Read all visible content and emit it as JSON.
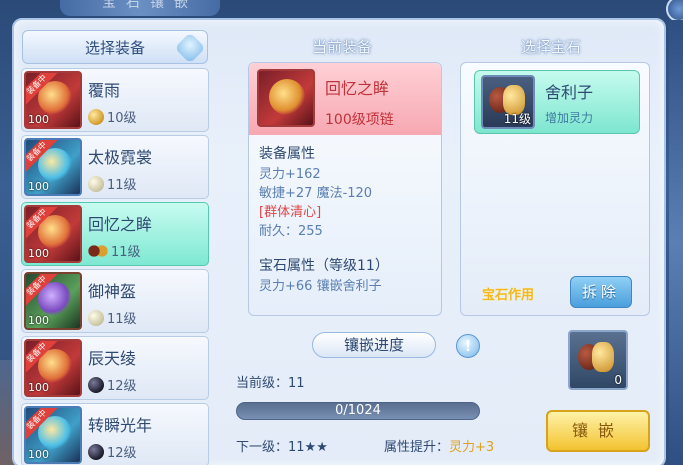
{
  "window": {
    "banner_text": "宝石镶嵌"
  },
  "left": {
    "header": "选择装备",
    "items": [
      {
        "name": "覆雨",
        "gem_level": "10级",
        "level_tag": "100",
        "ribbon": "装备中",
        "gem": "gold"
      },
      {
        "name": "太极霓裳",
        "gem_level": "11级",
        "level_tag": "100",
        "ribbon": "装备中",
        "gem": "silver"
      },
      {
        "name": "回忆之眸",
        "gem_level": "11级",
        "level_tag": "100",
        "ribbon": "装备中",
        "gem": "pair",
        "selected": true
      },
      {
        "name": "御神盔",
        "gem_level": "11级",
        "level_tag": "100",
        "ribbon": "装备中",
        "gem": "silver"
      },
      {
        "name": "辰天绫",
        "gem_level": "12级",
        "level_tag": "100",
        "ribbon": "装备中",
        "gem": "black"
      },
      {
        "name": "转瞬光年",
        "gem_level": "12级",
        "level_tag": "100",
        "ribbon": "装备中",
        "gem": "black"
      }
    ]
  },
  "center": {
    "title": "当前装备",
    "equip_name": "回忆之眸",
    "equip_type": "100级项链",
    "attr_title": "装备属性",
    "attrs": [
      "灵力+162",
      "敏捷+27 魔法-120",
      "[群体清心]",
      "耐久：255"
    ],
    "gem_attr_title": "宝石属性（等级11）",
    "gem_attr": "灵力+66 镶嵌舍利子",
    "progress_label": "镶嵌进度",
    "current_level": "当前级：11",
    "progress_value": 0,
    "progress_max": 1024,
    "progress_text": "0/1024",
    "next_level": "下一级：11★★",
    "attr_increase_label": "属性提升：",
    "attr_increase_value": "灵力+3"
  },
  "right": {
    "title": "选择宝石",
    "gem_name": "舍利子",
    "gem_desc": "增加灵力",
    "gem_level": "11级",
    "gem_effect": "宝石作用",
    "remove_label": "拆除",
    "slot_count": "0",
    "inlay_label": "镶嵌"
  }
}
